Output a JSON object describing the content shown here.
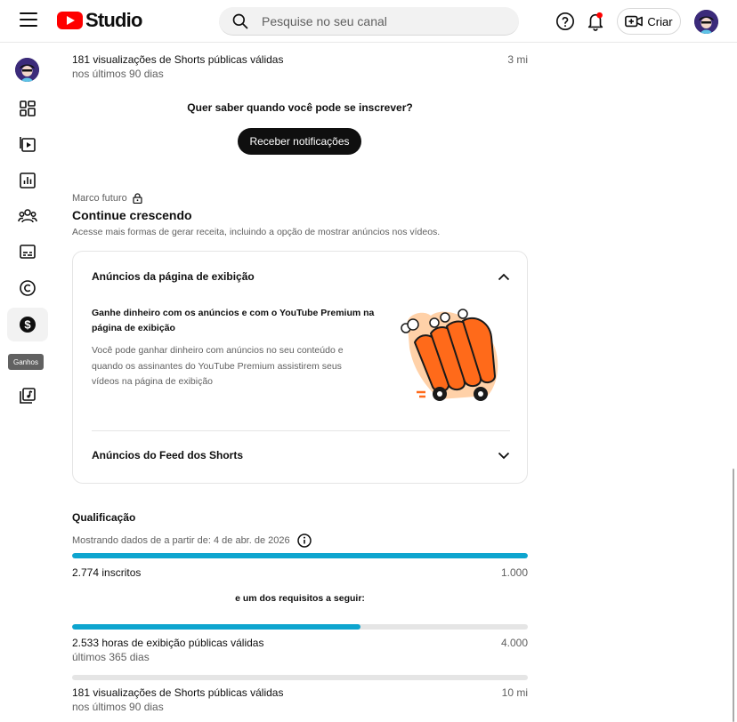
{
  "header": {
    "logo_text": "Studio",
    "search_placeholder": "Pesquise no seu canal",
    "create_label": "Criar"
  },
  "sidebar": {
    "tooltip": "Ganhos",
    "items": [
      "dashboard",
      "content",
      "analytics",
      "community",
      "subtitles",
      "copyright",
      "earn",
      "audio-library"
    ]
  },
  "top_metric": {
    "label": "181 visualizações de Shorts públicas válidas",
    "period": "nos últimos 90 dias",
    "target": "3 mi"
  },
  "subscribe_prompt": {
    "text": "Quer saber quando você pode se inscrever?",
    "button_label": "Receber notificações"
  },
  "milestone": {
    "label": "Marco futuro",
    "title": "Continue crescendo",
    "subtitle": "Acesse mais formas de gerar receita, incluindo a opção de mostrar anúncios nos vídeos."
  },
  "accordion": {
    "item1": {
      "title": "Anúncios da página de exibição",
      "body_title": "Ganhe dinheiro com os anúncios e com o YouTube Premium na página de exibição",
      "body_text": "Você pode ganhar dinheiro com anúncios no seu conteúdo e quando os assinantes do YouTube Premium assistirem seus vídeos na página de exibição"
    },
    "item2": {
      "title": "Anúncios do Feed dos Shorts"
    }
  },
  "qualification": {
    "title": "Qualificação",
    "subtitle": "Mostrando dados de a partir de: 4 de abr. de 2026",
    "requirement_text": "e um dos requisitos a seguir:",
    "subscribers": {
      "label": "2.774 inscritos",
      "target": "1.000",
      "progress": 1.0
    },
    "watch_hours": {
      "label": "2.533 horas de exibição públicas válidas",
      "period": "últimos 365 dias",
      "target": "4.000",
      "progress": 0.633
    },
    "shorts_views": {
      "label": "181 visualizações de Shorts públicas válidas",
      "period": "nos últimos 90 dias",
      "target": "10 mi",
      "progress": 0.0
    }
  },
  "colors": {
    "accent": "#0ea5cf",
    "brand": "#ff0000",
    "notification_dot": "#ff0000"
  }
}
